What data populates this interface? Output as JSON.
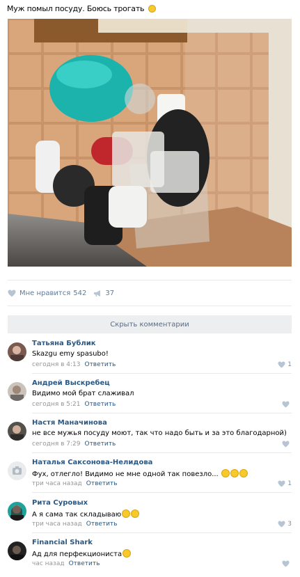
{
  "post": {
    "text": "Муж помыл посуду. Боюсь трогать",
    "likes_label": "Мне нравится",
    "likes_count": "542",
    "shares_count": "37"
  },
  "hide_comments_label": "Скрыть комментарии",
  "comments": [
    {
      "author": "Татьяна Бублик",
      "text": "Skazgu emy spasubo!",
      "time": "сегодня в 4:13",
      "reply": "Ответить",
      "likes": "1"
    },
    {
      "author": "Андрей Выскребец",
      "text": "Видимо мой брат слаживал",
      "time": "сегодня в 5:21",
      "reply": "Ответить",
      "likes": ""
    },
    {
      "author": "Настя Маначинова",
      "text": "не все мужья посуду моют, так что надо быть и за это благодарной)",
      "time": "сегодня в 7:29",
      "reply": "Ответить",
      "likes": ""
    },
    {
      "author": "Наталья Саксонова-Нелидова",
      "text": "Фух, отлегло! Видимо не мне одной так повезло...",
      "time": "три часа назад",
      "reply": "Ответить",
      "likes": "1"
    },
    {
      "author": "Рита Суровых",
      "text": "А я сама так складываю",
      "time": "три часа назад",
      "reply": "Ответить",
      "likes": "3"
    },
    {
      "author": "Financial Shark",
      "text": "Ад для перфекциониста",
      "time": "час назад",
      "reply": "Ответить",
      "likes": ""
    }
  ]
}
